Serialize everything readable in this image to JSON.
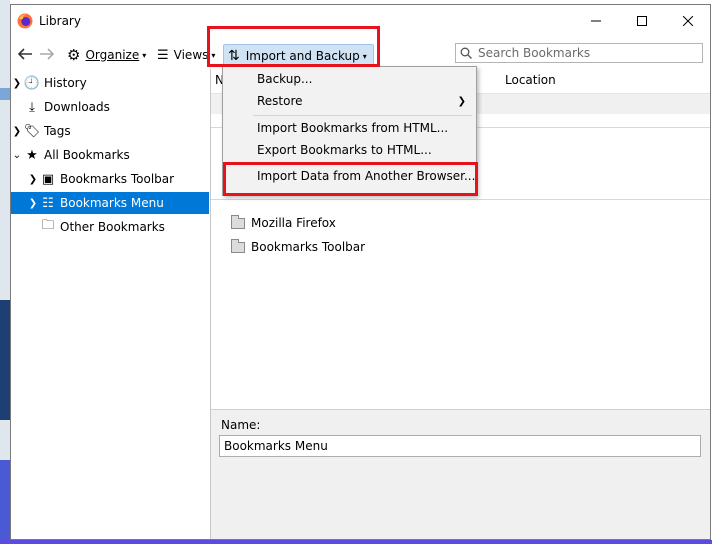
{
  "window": {
    "title": "Library",
    "minimize_icon": "minimize-icon",
    "maximize_icon": "maximize-icon",
    "close_icon": "close-icon"
  },
  "toolbar": {
    "back_icon": "arrow-left-icon",
    "forward_icon": "arrow-right-icon",
    "organize_label": "Organize",
    "views_label": "Views",
    "import_backup_label": "Import and Backup",
    "search_placeholder": "Search Bookmarks"
  },
  "sidebar": {
    "items": [
      {
        "label": "History",
        "icon": "clock-icon",
        "expandable": true
      },
      {
        "label": "Downloads",
        "icon": "download-icon",
        "expandable": false
      },
      {
        "label": "Tags",
        "icon": "tag-icon",
        "expandable": true
      },
      {
        "label": "All Bookmarks",
        "icon": "star-icon",
        "expandable": true,
        "expanded": true
      },
      {
        "label": "Bookmarks Toolbar",
        "icon": "toolbar-icon",
        "expandable": true
      },
      {
        "label": "Bookmarks Menu",
        "icon": "menu-list-icon",
        "expandable": true,
        "selected": true
      },
      {
        "label": "Other Bookmarks",
        "icon": "folder-icon",
        "expandable": false
      }
    ]
  },
  "content": {
    "columns": [
      "N",
      "Location"
    ],
    "folders": [
      "Mozilla Firefox",
      "Bookmarks Toolbar"
    ]
  },
  "details": {
    "name_label": "Name:",
    "name_value": "Bookmarks Menu"
  },
  "menu": {
    "items": [
      "Backup...",
      "Restore",
      "Import Bookmarks from HTML...",
      "Export Bookmarks to HTML...",
      "Import Data from Another Browser..."
    ]
  },
  "colors": {
    "selection": "#0078d7",
    "highlight_box": "#e8121c",
    "active_button": "#d0e3f5"
  }
}
